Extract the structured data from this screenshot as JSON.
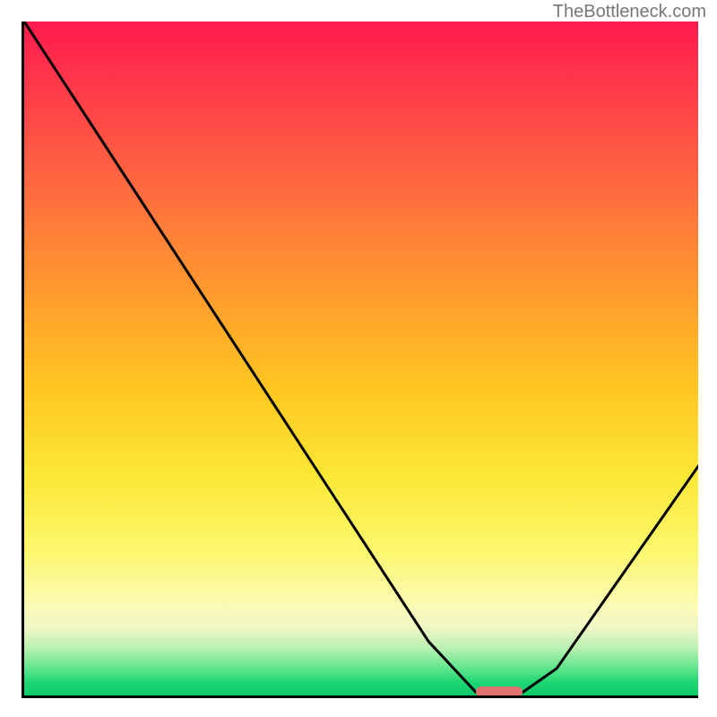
{
  "watermark": "TheBottleneck.com",
  "chart_data": {
    "type": "line",
    "title": "",
    "xlabel": "",
    "ylabel": "",
    "xlim": [
      0,
      100
    ],
    "ylim": [
      0,
      100
    ],
    "grid": false,
    "series": [
      {
        "name": "curve",
        "x": [
          0,
          15,
          60,
          67,
          74,
          79,
          100
        ],
        "values": [
          100,
          77,
          8,
          0.5,
          0.5,
          4,
          34
        ]
      }
    ],
    "background_gradient": {
      "stops": [
        {
          "pos": 0,
          "color": "#ff1a4d"
        },
        {
          "pos": 25,
          "color": "#ff6b3f"
        },
        {
          "pos": 55,
          "color": "#ffc820"
        },
        {
          "pos": 78,
          "color": "#fdf76a"
        },
        {
          "pos": 100,
          "color": "#10c96a"
        }
      ]
    },
    "marker": {
      "x_start": 67,
      "x_end": 74,
      "y": 0.5,
      "color": "#e17070"
    }
  }
}
